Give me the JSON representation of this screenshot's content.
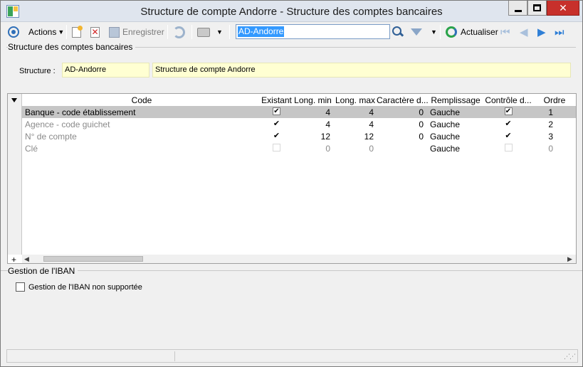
{
  "window": {
    "title": "Structure de compte Andorre -  Structure des comptes bancaires"
  },
  "toolbar": {
    "actions_label": "Actions",
    "save_label": "Enregistrer",
    "search_value": "AD-Andorre",
    "refresh_label": "Actualiser"
  },
  "structure_section": {
    "title": "Structure des comptes bancaires",
    "structure_label": "Structure :",
    "code": "AD-Andorre",
    "name": "Structure de compte Andorre"
  },
  "grid": {
    "columns": [
      "Code",
      "Existant",
      "Long. min",
      "Long. max",
      "Caractère d...",
      "Remplissage",
      "Contrôle d...",
      "Ordre"
    ],
    "rows": [
      {
        "code": "Banque - code établissement",
        "existant": true,
        "min": "4",
        "max": "4",
        "car": "0",
        "remplissage": "Gauche",
        "controle": true,
        "ordre": "1",
        "muted": false,
        "selected": true
      },
      {
        "code": "Agence - code guichet",
        "existant": true,
        "min": "4",
        "max": "4",
        "car": "0",
        "remplissage": "Gauche",
        "controle": true,
        "ordre": "2",
        "muted": true,
        "selected": false
      },
      {
        "code": "N° de compte",
        "existant": true,
        "min": "12",
        "max": "12",
        "car": "0",
        "remplissage": "Gauche",
        "controle": true,
        "ordre": "3",
        "muted": true,
        "selected": false
      },
      {
        "code": "Clé",
        "existant": false,
        "min": "0",
        "max": "0",
        "car": "",
        "remplissage": "Gauche",
        "controle": false,
        "ordre": "0",
        "muted": true,
        "selected": false
      }
    ],
    "add_label": "+"
  },
  "iban_section": {
    "title": "Gestion de l'IBAN",
    "checkbox_label": "Gestion de l'IBAN non supportée",
    "checked": false
  }
}
